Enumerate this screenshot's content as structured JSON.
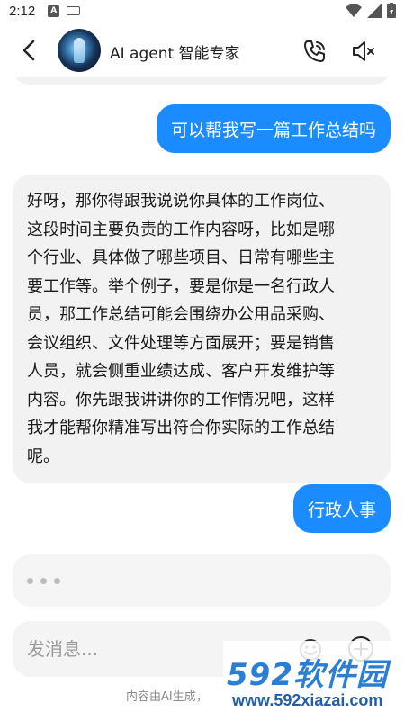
{
  "status_bar": {
    "time": "2:12"
  },
  "header": {
    "title": "AI agent 智能专家"
  },
  "messages": {
    "user_1": "可以帮我写一篇工作总结吗",
    "ai_1_lines": [
      "好呀，那你得跟我说说你具体的工作岗位、",
      "这段时间主要负责的工作内容呀，比如是哪",
      "个行业、具体做了哪些项目、日常有哪些主",
      "要工作等。举个例子，要是你是一名行政人",
      "员，那工作总结可能会围绕办公用品采购、",
      "会议组织、文件处理等方面展开；要是销售",
      "人员，就会侧重业绩达成、客户开发维护等",
      "内容。你先跟我讲讲你的工作情况吧，这样",
      "我才能帮你精准写出符合你实际的工作总结",
      "呢。"
    ],
    "user_2": "行政人事"
  },
  "input": {
    "placeholder": "发消息...",
    "value": ""
  },
  "footer": {
    "disclaimer": "内容由AI生成，"
  },
  "watermark": {
    "logo": "592软件园",
    "url": "www.592xiazai.com"
  },
  "colors": {
    "accent": "#1a8cff",
    "bubble_ai": "#f2f2f2"
  },
  "icons": [
    "back-arrow-icon",
    "phone-call-icon",
    "speaker-mute-icon",
    "emoji-icon",
    "plus-circle-icon"
  ]
}
